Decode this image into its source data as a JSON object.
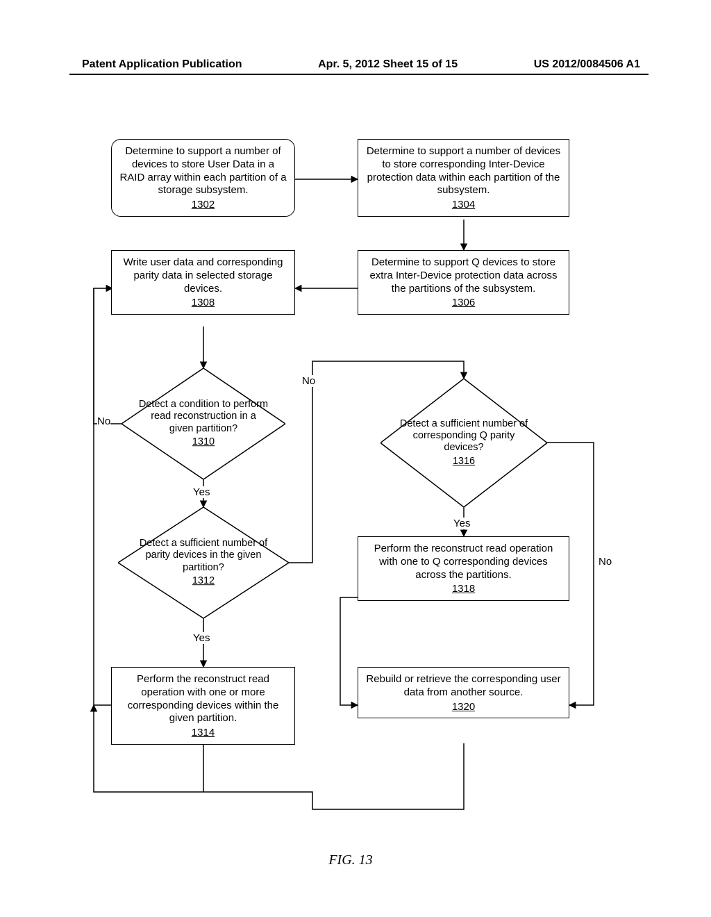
{
  "header": {
    "left": "Patent Application Publication",
    "center": "Apr. 5, 2012  Sheet 15 of 15",
    "right": "US 2012/0084506 A1"
  },
  "nodes": {
    "n1302": {
      "text": "Determine to support a number of devices to store User Data in a RAID array within each partition of a storage subsystem.",
      "ref": "1302"
    },
    "n1304": {
      "text": "Determine to support a number of devices to store corresponding Inter-Device protection data within each partition of the subsystem.",
      "ref": "1304"
    },
    "n1306": {
      "text": "Determine to support Q devices to store extra Inter-Device protection data across the partitions of the subsystem.",
      "ref": "1306"
    },
    "n1308": {
      "text": "Write user data and corresponding parity data in selected storage devices.",
      "ref": "1308"
    },
    "n1310": {
      "text": "Detect a condition to perform read reconstruction in a given partition?",
      "ref": "1310"
    },
    "n1312": {
      "text": "Detect a sufficient number of parity devices in the given partition?",
      "ref": "1312"
    },
    "n1314": {
      "text": "Perform the reconstruct read operation with one or more corresponding devices  within the given partition.",
      "ref": "1314"
    },
    "n1316": {
      "text": "Detect a sufficient number of corresponding Q parity devices?",
      "ref": "1316"
    },
    "n1318": {
      "text": "Perform the reconstruct read operation with one to Q corresponding devices across the partitions.",
      "ref": "1318"
    },
    "n1320": {
      "text": "Rebuild or retrieve the corresponding user data from another source.",
      "ref": "1320"
    }
  },
  "labels": {
    "no": "No",
    "yes": "Yes"
  },
  "figure_caption": "FIG. 13"
}
